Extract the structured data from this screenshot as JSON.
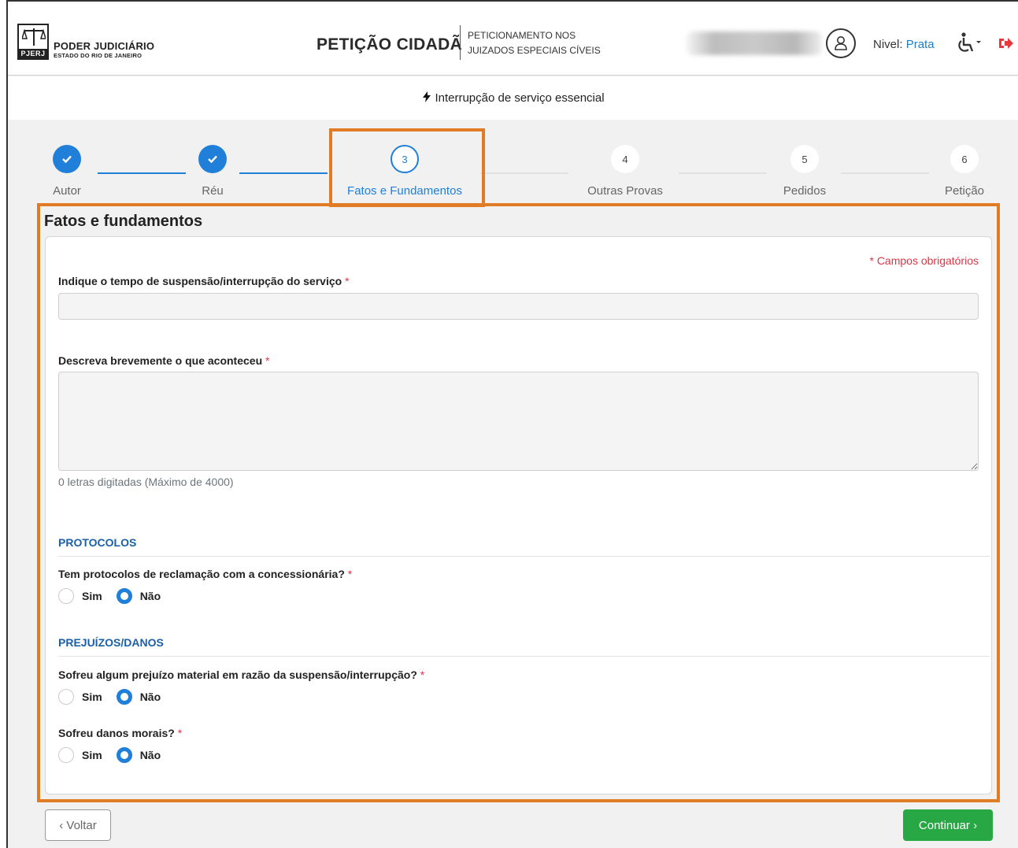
{
  "header": {
    "logo": {
      "abbr": "PJERJ",
      "line1": "PODER JUDICIÁRIO",
      "line2": "ESTADO DO RIO DE JANEIRO"
    },
    "app_title": "PETIÇÃO CIDADÃ",
    "app_subtitle_line1": "PETICIONAMENTO NOS",
    "app_subtitle_line2": "JUIZADOS ESPECIAIS CÍVEIS",
    "nivel_label": "Nivel:",
    "nivel_value": "Prata",
    "user_icon": "user-circle-icon",
    "accessibility_icon": "wheelchair-icon",
    "logout_icon": "sign-out-icon"
  },
  "subheader": {
    "icon": "bolt-icon",
    "text": "Interrupção de serviço essencial"
  },
  "stepper": {
    "steps": [
      {
        "number": "1",
        "label": "Autor",
        "state": "done"
      },
      {
        "number": "2",
        "label": "Réu",
        "state": "done"
      },
      {
        "number": "3",
        "label": "Fatos e Fundamentos",
        "state": "active"
      },
      {
        "number": "4",
        "label": "Outras Provas",
        "state": "todo"
      },
      {
        "number": "5",
        "label": "Pedidos",
        "state": "todo"
      },
      {
        "number": "6",
        "label": "Petição",
        "state": "todo"
      }
    ]
  },
  "form": {
    "title": "Fatos e fundamentos",
    "required_note": "* Campos obrigatórios",
    "tempo": {
      "label": "Indique o tempo de suspensão/interrupção do serviço",
      "required": "*",
      "value": ""
    },
    "descricao": {
      "label": "Descreva brevemente o que aconteceu",
      "required": "*",
      "value": "",
      "counter": "0 letras digitadas (Máximo de 4000)"
    },
    "protocolos": {
      "heading": "PROTOCOLOS",
      "question": "Tem protocolos de reclamação com a concessionária?",
      "required": "*",
      "options": [
        "Sim",
        "Não"
      ],
      "selected": "Não"
    },
    "prejuizos": {
      "heading": "PREJUÍZOS/DANOS",
      "material_question": "Sofreu algum prejuízo material em razão da suspensão/interrupção?",
      "material_required": "*",
      "material_selected": "Não",
      "morais_question": "Sofreu danos morais?",
      "morais_required": "*",
      "morais_selected": "Não",
      "options": [
        "Sim",
        "Não"
      ]
    }
  },
  "buttons": {
    "back": "‹ Voltar",
    "next": "Continuar ›"
  },
  "colors": {
    "primary": "#1f7fd9",
    "success": "#28a745",
    "danger": "#dc3545",
    "highlight": "#e07b26"
  }
}
